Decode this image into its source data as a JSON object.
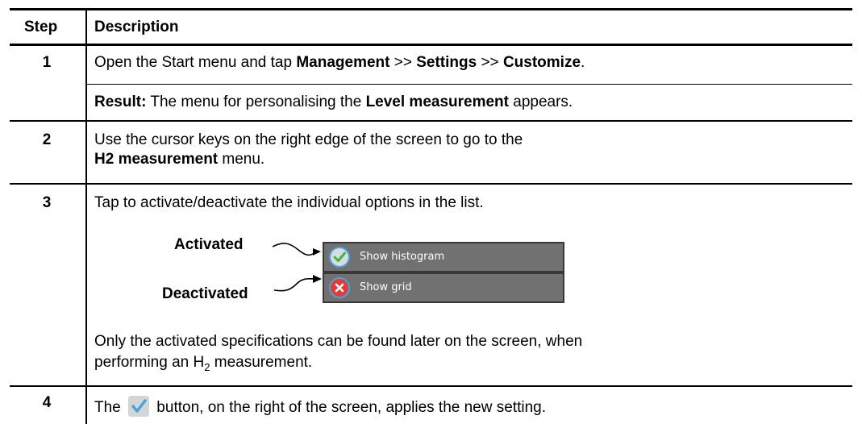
{
  "header": {
    "step": "Step",
    "description": "Description"
  },
  "rows": [
    {
      "step": "1",
      "line1_pre": "Open the Start menu and tap ",
      "line1_b1": "Management",
      "line1_sep1": " >> ",
      "line1_b2": "Settings",
      "line1_sep2": " >> ",
      "line1_b3": "Customize",
      "line1_end": ".",
      "result_label": "Result:",
      "result_pre": " The menu for personalising the ",
      "result_bold": "Level measurement",
      "result_end": " appears."
    },
    {
      "step": "2",
      "line1": "Use the cursor keys on the right edge of the screen to go to the",
      "line2_bold": "H2 measurement",
      "line2_end": " menu."
    },
    {
      "step": "3",
      "line1": "Tap to activate/deactivate the individual options in the list.",
      "activated_label": "Activated",
      "deactivated_label": "Deactivated",
      "option1": "Show histogram",
      "option2": "Show grid",
      "note_line1": "Only the activated specifications can be found later on the screen, when",
      "note_line2_pre": "performing an H",
      "note_line2_sub": "2",
      "note_line2_end": " measurement."
    },
    {
      "step": "4",
      "pre": "The ",
      "post": " button, on the right of the screen, applies the new setting."
    }
  ],
  "colors": {
    "option_bg": "#717171",
    "activated_check": "#3fb54a",
    "deactivated_x": "#e23b3b",
    "icon_ring": "#4aa3d8"
  },
  "icons": {
    "activated": "check-circle-icon",
    "deactivated": "x-circle-icon",
    "apply": "checkmark-button-icon"
  }
}
